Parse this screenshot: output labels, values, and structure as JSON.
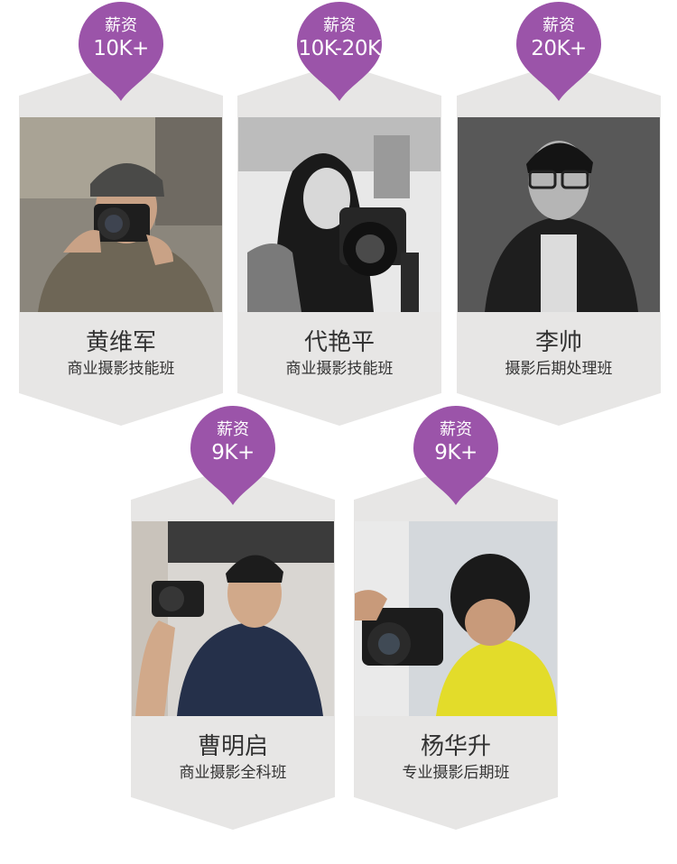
{
  "colors": {
    "badge": "#9b54a9",
    "card": "#e7e6e5",
    "text": "#333333"
  },
  "cards": [
    {
      "salary_label": "薪资",
      "salary": "10K+",
      "name": "黄维军",
      "course": "商业摄影技能班"
    },
    {
      "salary_label": "薪资",
      "salary": "10K-20K",
      "name": "代艳平",
      "course": "商业摄影技能班"
    },
    {
      "salary_label": "薪资",
      "salary": "20K+",
      "name": "李帅",
      "course": "摄影后期处理班"
    },
    {
      "salary_label": "薪资",
      "salary": "9K+",
      "name": "曹明启",
      "course": "商业摄影全科班"
    },
    {
      "salary_label": "薪资",
      "salary": "9K+",
      "name": "杨华升",
      "course": "专业摄影后期班"
    }
  ]
}
